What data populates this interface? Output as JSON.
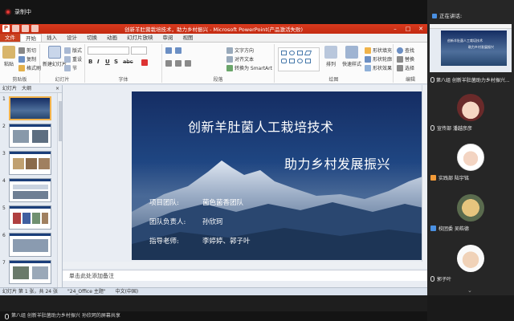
{
  "meeting": {
    "recording_label": "录制中",
    "speaking_label": "正在讲话:",
    "share_label": "第八组 创新羊肚菌助力乡村振兴 孙欣珂的屏幕共享",
    "preview_label": "第八组 创新羊肚菌助力乡村振兴..."
  },
  "participants": [
    {
      "name": "宣传部 潘越彦彦",
      "tag_color": "#9aa0a6"
    },
    {
      "name": "实践部 陆宇铭",
      "tag_color": "#f29a38"
    },
    {
      "name": "校团委 吴皓德",
      "tag_color": "#4a90e2"
    },
    {
      "name": "郭子叶",
      "tag_color": "#9aa0a6"
    }
  ],
  "ppt": {
    "window_title": "创新羊肚菌栽培技术，助力乡村振兴 - Microsoft PowerPoint(产品激活失败)",
    "tabs": [
      "文件",
      "开始",
      "插入",
      "设计",
      "切换",
      "动画",
      "幻灯片放映",
      "审阅",
      "视图"
    ],
    "active_tab": "开始",
    "ribbon": {
      "paste": "粘贴",
      "cut": "剪切",
      "copy": "复制",
      "format_painter": "格式刷",
      "new_slide": "新建幻灯片",
      "layout": "版式",
      "reset": "重设",
      "section": "节",
      "text_direction": "文字方向",
      "align_text": "对齐文本",
      "smartart": "转换为 SmartArt",
      "arrange": "排列",
      "quick_styles": "快速样式",
      "shape_fill": "形状填充",
      "shape_outline": "形状轮廓",
      "shape_effects": "形状效果",
      "find": "查找",
      "replace": "替换",
      "select": "选择",
      "groups": [
        "剪贴板",
        "幻灯片",
        "字体",
        "段落",
        "绘图",
        "编辑"
      ],
      "format_buttons": [
        "B",
        "I",
        "U",
        "S",
        "abc"
      ]
    },
    "left_panel": {
      "tab_slides": "幻灯片",
      "tab_outline": "大纲",
      "close": "×",
      "slide_numbers": [
        "1",
        "2",
        "3",
        "4",
        "5",
        "6",
        "7"
      ]
    },
    "slide": {
      "title": "创新羊肚菌人工栽培技术",
      "subtitle": "助力乡村发展振兴",
      "team_label": "项目团队:",
      "team_value": "菌色菌香团队",
      "leader_label": "团队负责人:",
      "leader_value": "孙欣珂",
      "advisor_label": "指导老师:",
      "advisor_value": "李婷婷、郭子叶"
    },
    "notes_placeholder": "单击此处添加备注",
    "status": {
      "slide_info": "幻灯片 第 1 张，共 24 张",
      "theme": "\"24_Office 主题\"",
      "language": "中文(中国)"
    }
  }
}
